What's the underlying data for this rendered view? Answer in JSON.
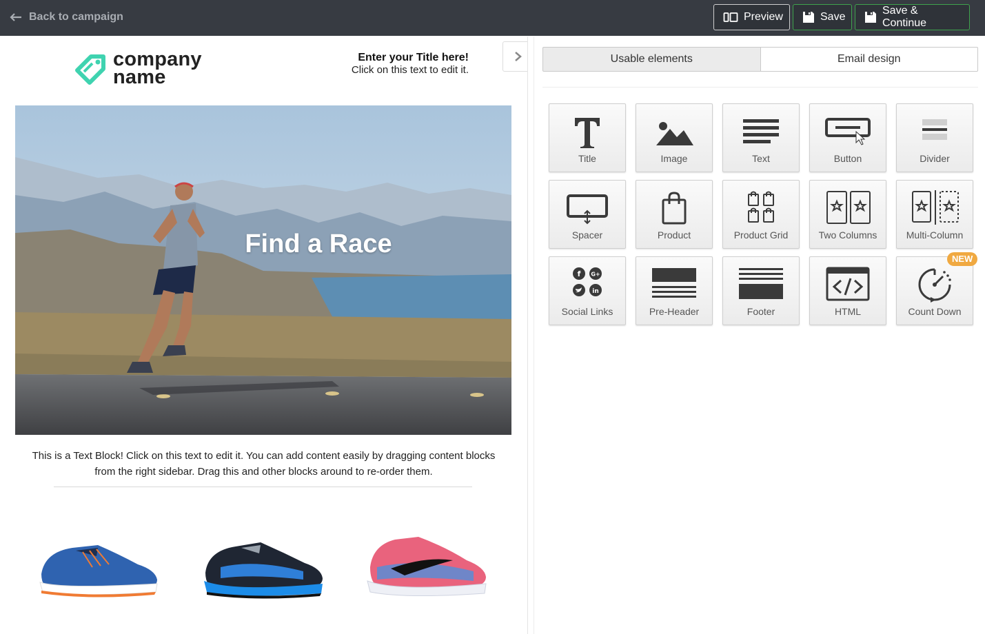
{
  "topbar": {
    "back_label": "Back to campaign",
    "preview_label": "Preview",
    "save_label": "Save",
    "save_continue_label": "Save & Continue"
  },
  "email": {
    "logo_text_line1": "company",
    "logo_text_line2": "name",
    "header_title": "Enter your Title here!",
    "header_subtitle": "Click on this text to edit it.",
    "hero_text": "Find a Race",
    "text_block": "This is a Text Block! Click on this text to edit it. You can add content easily by dragging content blocks from the right sidebar. Drag this and other blocks around to re-order them."
  },
  "panel": {
    "tabs": [
      {
        "label": "Usable elements",
        "active": true
      },
      {
        "label": "Email design",
        "active": false
      }
    ],
    "elements": [
      {
        "label": "Title",
        "icon": "title-icon"
      },
      {
        "label": "Image",
        "icon": "image-icon"
      },
      {
        "label": "Text",
        "icon": "text-icon"
      },
      {
        "label": "Button",
        "icon": "button-icon"
      },
      {
        "label": "Divider",
        "icon": "divider-icon"
      },
      {
        "label": "Spacer",
        "icon": "spacer-icon"
      },
      {
        "label": "Product",
        "icon": "shopping-bag-icon"
      },
      {
        "label": "Product Grid",
        "icon": "product-grid-icon"
      },
      {
        "label": "Two Columns",
        "icon": "two-columns-icon"
      },
      {
        "label": "Multi-Column",
        "icon": "multi-column-icon"
      },
      {
        "label": "Social Links",
        "icon": "social-links-icon"
      },
      {
        "label": "Pre-Header",
        "icon": "pre-header-icon"
      },
      {
        "label": "Footer",
        "icon": "footer-icon"
      },
      {
        "label": "HTML",
        "icon": "html-code-icon"
      },
      {
        "label": "Count Down",
        "icon": "countdown-timer-icon"
      }
    ],
    "new_badge": "NEW"
  },
  "colors": {
    "topbar_bg": "#373b42",
    "save_border": "#3fa34d",
    "badge": "#f0a941",
    "logo_accent": "#3fd3b0"
  }
}
